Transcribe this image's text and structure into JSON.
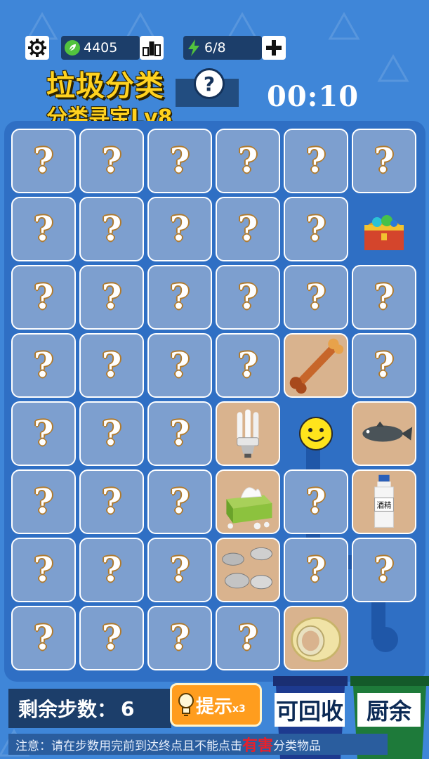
{
  "header": {
    "coins": "4405",
    "energy": "6/8",
    "title": "垃圾分类",
    "subtitle": "分类寻宝Lv8",
    "timer": "00:10",
    "help_symbol": "?"
  },
  "board": {
    "hidden_symbol": "?",
    "columns": 6,
    "rows": 8,
    "items": [
      {
        "row": 1,
        "col": 6,
        "item": "treasure-chest"
      },
      {
        "row": 3,
        "col": 5,
        "item": "bone"
      },
      {
        "row": 4,
        "col": 4,
        "item": "energy-saving-bulb"
      },
      {
        "row": 4,
        "col": 5,
        "item": "smiley-player"
      },
      {
        "row": 4,
        "col": 6,
        "item": "fish"
      },
      {
        "row": 5,
        "col": 4,
        "item": "tissue-box"
      },
      {
        "row": 5,
        "col": 6,
        "item": "alcohol-bottle"
      },
      {
        "row": 6,
        "col": 4,
        "item": "button-batteries"
      },
      {
        "row": 7,
        "col": 5,
        "item": "tape-roll"
      }
    ],
    "alcohol_label": "酒精"
  },
  "footer": {
    "steps_label": "剩余步数：",
    "steps_value": "6",
    "hint_label": "提示",
    "hint_count": "x3",
    "notice_before": "注意：请在步数用完前到达终点且不能点击",
    "notice_highlight": "有害",
    "notice_after": "分类物品"
  },
  "bins": [
    {
      "label": "可回收",
      "color": "#1d3a8f"
    },
    {
      "label": "厨余",
      "color": "#1e7a3a"
    }
  ],
  "colors": {
    "background": "#3f86d8",
    "board": "#2f6fc4",
    "tile": "#7d9fcf",
    "item_tile": "#d9b38e",
    "title": "#ffd21f",
    "hint_button": "#ff9d1e",
    "warning": "#e8202a"
  }
}
